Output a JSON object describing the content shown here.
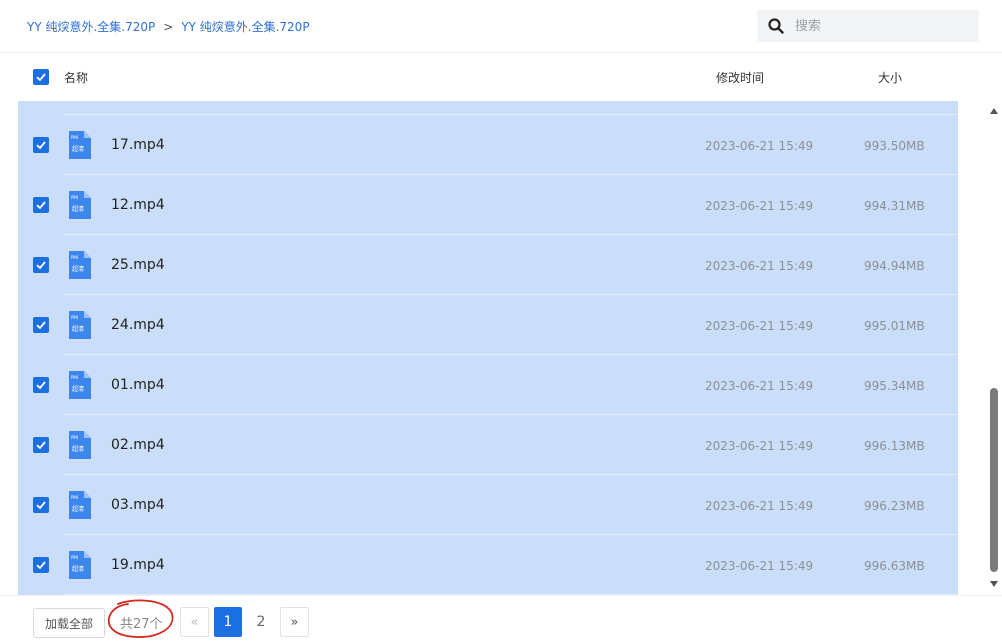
{
  "breadcrumb": {
    "items": [
      "YY 纯㷝意外.全集.720P",
      "YY 纯㷝意外.全集.720P"
    ],
    "separator": ">"
  },
  "search": {
    "placeholder": "搜索",
    "value": ""
  },
  "columns": {
    "name": "名称",
    "modified": "修改时间",
    "size": "大小"
  },
  "file_icon": {
    "badge_top": "PMI",
    "badge_text": "超清"
  },
  "files": [
    {
      "name": "17.mp4",
      "modified": "2023-06-21 15:49",
      "size": "993.50MB",
      "checked": true
    },
    {
      "name": "12.mp4",
      "modified": "2023-06-21 15:49",
      "size": "994.31MB",
      "checked": true
    },
    {
      "name": "25.mp4",
      "modified": "2023-06-21 15:49",
      "size": "994.94MB",
      "checked": true
    },
    {
      "name": "24.mp4",
      "modified": "2023-06-21 15:49",
      "size": "995.01MB",
      "checked": true
    },
    {
      "name": "01.mp4",
      "modified": "2023-06-21 15:49",
      "size": "995.34MB",
      "checked": true
    },
    {
      "name": "02.mp4",
      "modified": "2023-06-21 15:49",
      "size": "996.13MB",
      "checked": true
    },
    {
      "name": "03.mp4",
      "modified": "2023-06-21 15:49",
      "size": "996.23MB",
      "checked": true
    },
    {
      "name": "19.mp4",
      "modified": "2023-06-21 15:49",
      "size": "996.63MB",
      "checked": true
    }
  ],
  "footer": {
    "load_all_label": "加载全部",
    "total_text": "共27个",
    "prev": "«",
    "next": "»",
    "pages": [
      "1",
      "2"
    ],
    "current_page": "1"
  },
  "colors": {
    "accent": "#1c6fe0",
    "selected_row": "#cadef9",
    "annotation": "#d42a1e"
  }
}
